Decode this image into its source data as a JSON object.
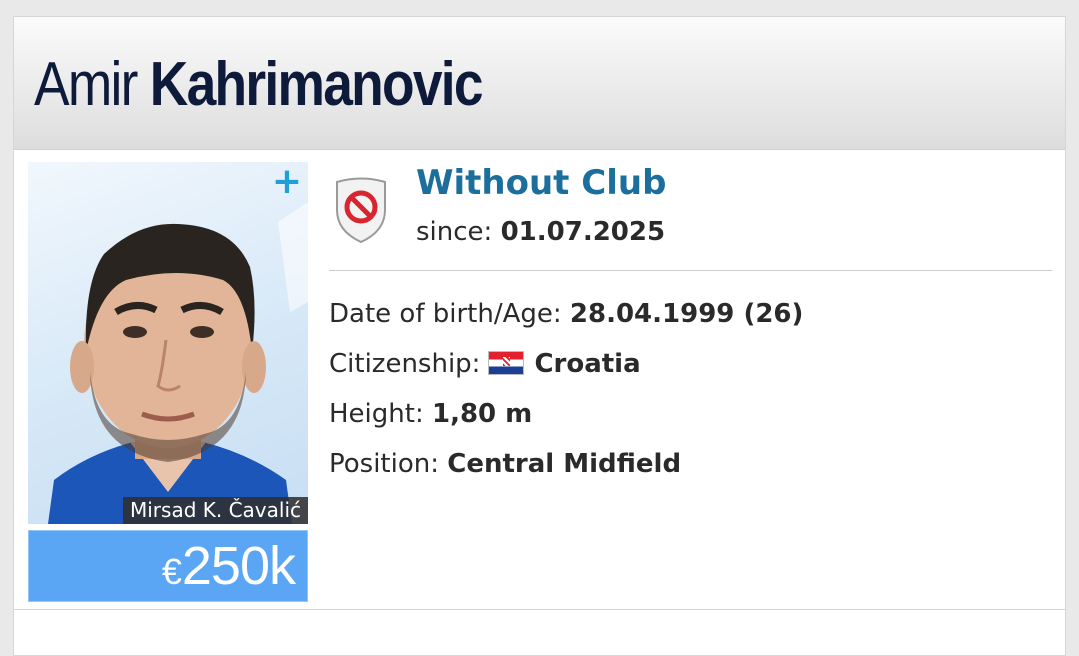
{
  "player": {
    "first_name": "Amir",
    "last_name": "Kahrimanovic",
    "photo_credit": "Mirsad K. Čavalić",
    "market_value_currency": "€",
    "market_value_amount": "250k"
  },
  "club": {
    "name": "Without Club",
    "since_label": "since:",
    "since_value": "01.07.2025",
    "icon": "no-club-shield-icon"
  },
  "details": {
    "dob_label": "Date of birth/Age:",
    "dob_value": "28.04.1999 (26)",
    "citizenship_label": "Citizenship:",
    "citizenship_value": "Croatia",
    "height_label": "Height:",
    "height_value": "1,80 m",
    "position_label": "Position:",
    "position_value": "Central Midfield"
  },
  "colors": {
    "name_color": "#0e1a3a",
    "club_color": "#1c6f9c",
    "value_bg": "#5aa6f5",
    "plus_color": "#1e9fd8"
  }
}
